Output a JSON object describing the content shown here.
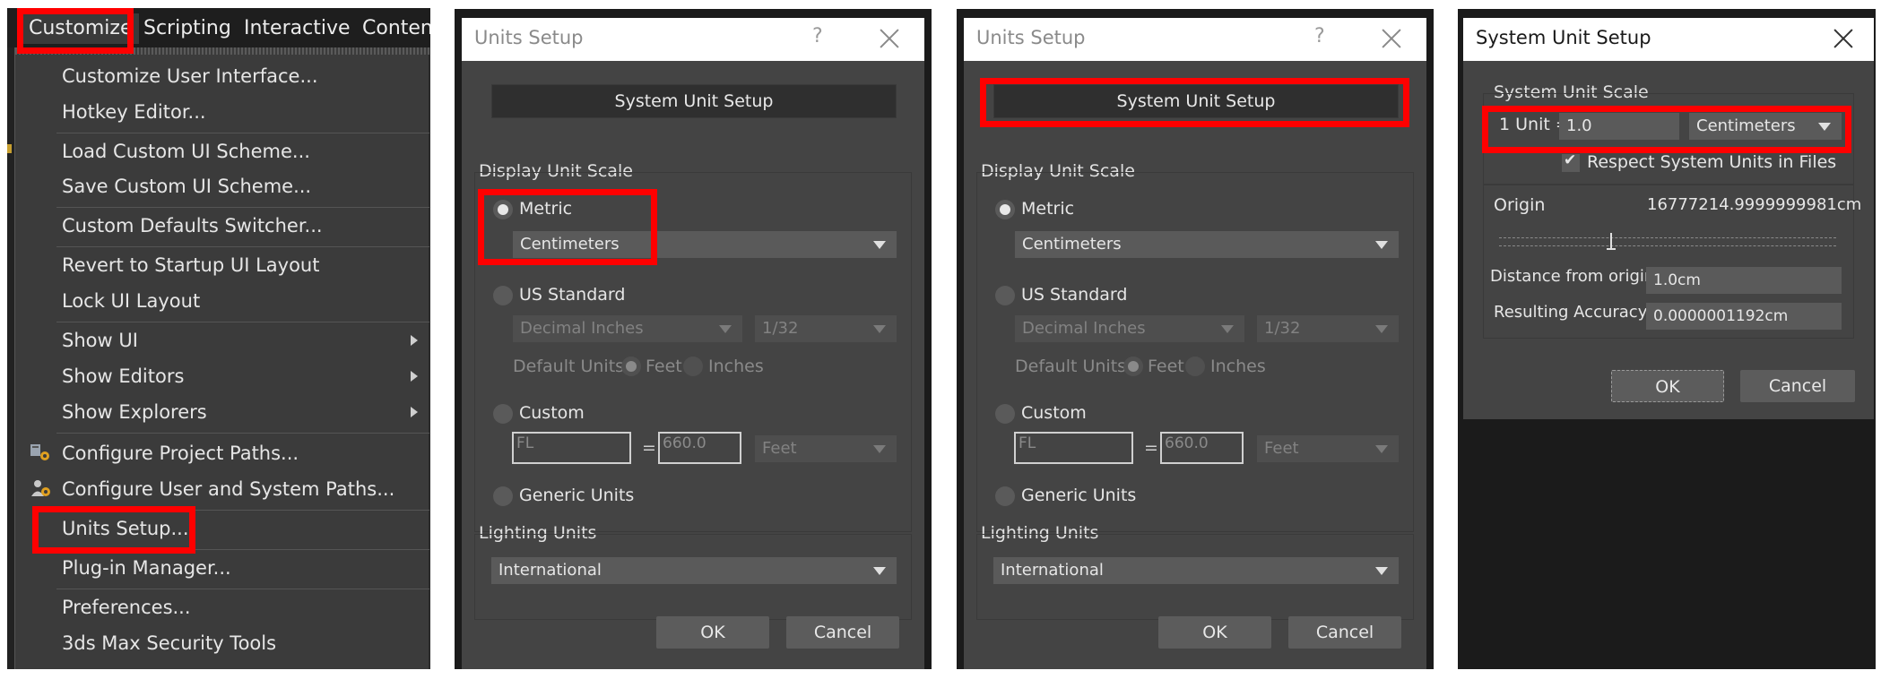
{
  "menubar": {
    "items": [
      "Customize",
      "Scripting",
      "Interactive",
      "Content"
    ]
  },
  "customize_menu": {
    "items": [
      "Customize User Interface...",
      "Hotkey Editor...",
      "Load Custom UI Scheme...",
      "Save Custom UI Scheme...",
      "Custom Defaults Switcher...",
      "Revert to Startup UI Layout",
      "Lock UI Layout",
      "Show UI",
      "Show Editors",
      "Show Explorers",
      "Configure Project Paths...",
      "Configure User and System Paths...",
      "Units Setup...",
      "Plug-in Manager...",
      "Preferences...",
      "3ds Max Security Tools"
    ],
    "icons": [
      "project-paths-icon",
      "user-system-paths-icon",
      "submenu-arrow-icon"
    ]
  },
  "units_dialog": {
    "title": "Units Setup",
    "help": "?",
    "system_unit_setup": "System Unit Setup",
    "display_unit_scale": "Display Unit Scale",
    "metric": "Metric",
    "metric_unit": "Centimeters",
    "us_standard": "US Standard",
    "us_unit": "Decimal Inches",
    "us_fraction": "1/32",
    "default_units": "Default Units:",
    "feet": "Feet",
    "inches": "Inches",
    "custom": "Custom",
    "custom_name": "FL",
    "equals": "=",
    "custom_value": "660.0",
    "custom_unit": "Feet",
    "generic_units": "Generic Units",
    "lighting_units": "Lighting Units",
    "lighting_value": "International",
    "ok": "OK",
    "cancel": "Cancel"
  },
  "system_dialog": {
    "title": "System Unit Setup",
    "scale_group": "System Unit Scale",
    "one_unit": "1 Unit =",
    "unit_value": "1.0",
    "unit_type": "Centimeters",
    "respect": "Respect System Units in Files",
    "origin": "Origin",
    "origin_value": "16777214.9999999981cm",
    "distance_label": "Distance from origin:",
    "distance_value": "1.0cm",
    "accuracy_label": "Resulting Accuracy:",
    "accuracy_value": "0.0000001192cm",
    "ok": "OK",
    "cancel": "Cancel"
  },
  "colors": {
    "highlight": "#ff0000",
    "dialog_bg": "#444444",
    "menu_bg": "#3b3b3b"
  }
}
